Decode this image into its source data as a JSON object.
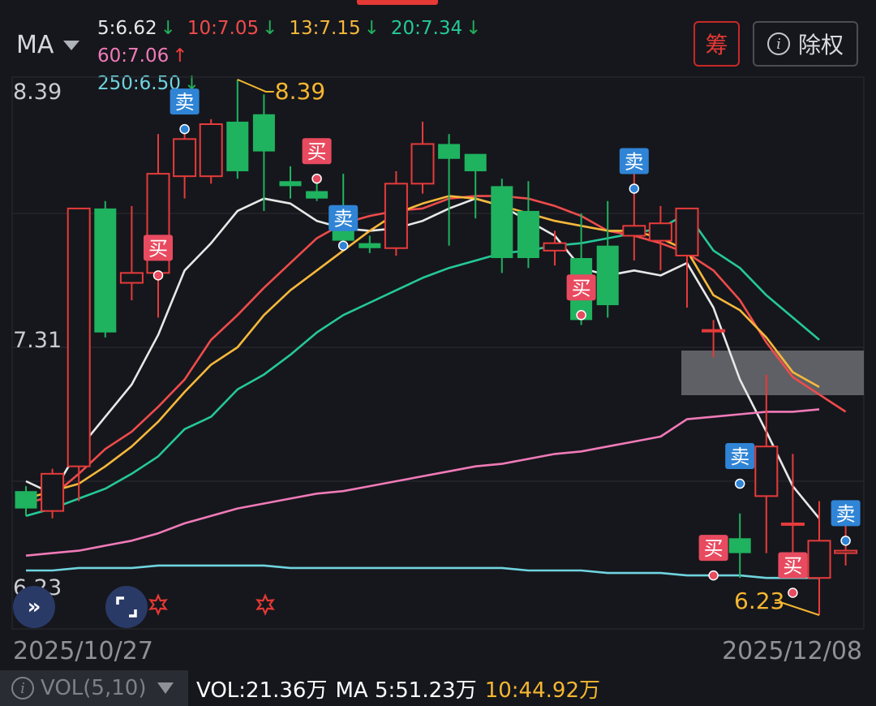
{
  "header": {
    "ma_selector": "MA",
    "chip_button": "筹",
    "rights_button": "除权",
    "legend": [
      {
        "text": "5:6.62",
        "arrow": "↓",
        "color": "#e8e8e8",
        "arrow_color": "#20b15b"
      },
      {
        "text": "10:7.05",
        "arrow": "↓",
        "color": "#ef4b4b",
        "arrow_color": "#20b15b"
      },
      {
        "text": "13:7.15",
        "arrow": "↓",
        "color": "#f6b83c",
        "arrow_color": "#20b15b"
      },
      {
        "text": "20:7.34",
        "arrow": "↓",
        "color": "#25c89a",
        "arrow_color": "#20b15b"
      },
      {
        "text": "60:7.06",
        "arrow": "↑",
        "color": "#f07ab8",
        "arrow_color": "#ef3b3b"
      },
      {
        "text": "250:6.50",
        "arrow": "↓",
        "color": "#6fd4df",
        "arrow_color": "#20b15b"
      }
    ]
  },
  "colors": {
    "up": "#e53b3b",
    "down": "#1fb35f",
    "signal_buy": "#e84a5f",
    "signal_sell": "#2f84d6",
    "annotation": "#f5b631",
    "star": "#e53935"
  },
  "chart_data": {
    "type": "candlestick",
    "x_start_label": "2025/10/27",
    "x_end_label": "2025/12/08",
    "y_axis_labels": [
      "8.39",
      "7.31",
      "6.23"
    ],
    "ylim": [
      6.23,
      8.39
    ],
    "high_annotation": "8.39",
    "low_annotation": "6.23",
    "candles": [
      {
        "o": 6.73,
        "h": 6.75,
        "l": 6.63,
        "c": 6.66
      },
      {
        "o": 6.65,
        "h": 6.82,
        "l": 6.62,
        "c": 6.8
      },
      {
        "o": 6.83,
        "h": 7.87,
        "l": 6.69,
        "c": 7.87
      },
      {
        "o": 7.87,
        "h": 7.9,
        "l": 7.35,
        "c": 7.37
      },
      {
        "o": 7.57,
        "h": 7.88,
        "l": 7.5,
        "c": 7.61
      },
      {
        "o": 7.61,
        "h": 8.17,
        "l": 7.43,
        "c": 8.01
      },
      {
        "o": 8.0,
        "h": 8.19,
        "l": 7.91,
        "c": 8.15
      },
      {
        "o": 8.0,
        "h": 8.23,
        "l": 7.97,
        "c": 8.21
      },
      {
        "o": 8.22,
        "h": 8.39,
        "l": 7.99,
        "c": 8.02
      },
      {
        "o": 8.25,
        "h": 8.33,
        "l": 7.86,
        "c": 8.1
      },
      {
        "o": 7.98,
        "h": 8.04,
        "l": 7.91,
        "c": 7.96
      },
      {
        "o": 7.94,
        "h": 7.99,
        "l": 7.9,
        "c": 7.91
      },
      {
        "o": 7.86,
        "h": 8.01,
        "l": 7.77,
        "c": 7.74
      },
      {
        "o": 7.73,
        "h": 7.76,
        "l": 7.69,
        "c": 7.71
      },
      {
        "o": 7.71,
        "h": 8.02,
        "l": 7.68,
        "c": 7.97
      },
      {
        "o": 7.97,
        "h": 8.22,
        "l": 7.93,
        "c": 8.13
      },
      {
        "o": 8.13,
        "h": 8.17,
        "l": 7.72,
        "c": 8.07
      },
      {
        "o": 8.09,
        "h": 8.05,
        "l": 7.83,
        "c": 8.02
      },
      {
        "o": 7.96,
        "h": 7.99,
        "l": 7.61,
        "c": 7.67
      },
      {
        "o": 7.86,
        "h": 7.98,
        "l": 7.63,
        "c": 7.67
      },
      {
        "o": 7.7,
        "h": 7.78,
        "l": 7.64,
        "c": 7.73
      },
      {
        "o": 7.67,
        "h": 7.85,
        "l": 7.4,
        "c": 7.42
      },
      {
        "o": 7.72,
        "h": 7.9,
        "l": 7.43,
        "c": 7.48
      },
      {
        "o": 7.76,
        "h": 8.08,
        "l": 7.66,
        "c": 7.8
      },
      {
        "o": 7.74,
        "h": 7.88,
        "l": 7.62,
        "c": 7.81
      },
      {
        "o": 7.68,
        "h": 7.83,
        "l": 7.47,
        "c": 7.87
      },
      {
        "o": 7.38,
        "h": 7.42,
        "l": 7.27,
        "c": 7.38
      },
      {
        "o": 6.54,
        "h": 6.64,
        "l": 6.38,
        "c": 6.48
      },
      {
        "o": 6.71,
        "h": 7.2,
        "l": 6.48,
        "c": 6.91
      },
      {
        "o": 6.6,
        "h": 6.88,
        "l": 6.4,
        "c": 6.6
      },
      {
        "o": 6.38,
        "h": 6.69,
        "l": 6.23,
        "c": 6.53
      },
      {
        "o": 6.48,
        "h": 6.62,
        "l": 6.43,
        "c": 6.49
      }
    ],
    "series": [
      {
        "name": "MA5",
        "color": "#e8e8e8",
        "values": [
          6.77,
          6.72,
          6.9,
          7.03,
          7.16,
          7.36,
          7.62,
          7.73,
          7.86,
          7.91,
          7.89,
          7.82,
          7.79,
          7.78,
          7.79,
          7.82,
          7.87,
          7.91,
          7.88,
          7.82,
          7.76,
          7.63,
          7.6,
          7.62,
          7.6,
          7.65,
          7.47,
          7.18,
          6.97,
          6.75,
          6.62
        ]
      },
      {
        "name": "MA10",
        "color": "#ef4b4b",
        "values": [
          6.68,
          6.71,
          6.8,
          6.9,
          6.97,
          7.07,
          7.18,
          7.34,
          7.44,
          7.55,
          7.65,
          7.75,
          7.81,
          7.84,
          7.86,
          7.87,
          7.91,
          7.92,
          7.92,
          7.91,
          7.88,
          7.84,
          7.78,
          7.76,
          7.73,
          7.69,
          7.62,
          7.5,
          7.33,
          7.19,
          7.12,
          7.05
        ]
      },
      {
        "name": "MA13",
        "color": "#f6b83c",
        "values": [
          6.7,
          6.73,
          6.76,
          6.83,
          6.91,
          7.01,
          7.13,
          7.24,
          7.31,
          7.44,
          7.54,
          7.62,
          7.7,
          7.78,
          7.85,
          7.89,
          7.92,
          7.91,
          7.88,
          7.85,
          7.82,
          7.8,
          7.78,
          7.78,
          7.75,
          7.7,
          7.52,
          7.46,
          7.35,
          7.21,
          7.15
        ]
      },
      {
        "name": "MA20",
        "color": "#25c89a",
        "values": [
          6.63,
          6.66,
          6.7,
          6.74,
          6.8,
          6.87,
          6.98,
          7.03,
          7.14,
          7.2,
          7.28,
          7.37,
          7.44,
          7.49,
          7.54,
          7.59,
          7.63,
          7.66,
          7.69,
          7.7,
          7.72,
          7.73,
          7.75,
          7.77,
          7.79,
          7.85,
          7.7,
          7.63,
          7.52,
          7.43,
          7.34
        ]
      },
      {
        "name": "MA60",
        "color": "#f07ab8",
        "values": [
          6.47,
          6.48,
          6.49,
          6.51,
          6.53,
          6.56,
          6.6,
          6.63,
          6.66,
          6.68,
          6.7,
          6.72,
          6.73,
          6.75,
          6.77,
          6.79,
          6.81,
          6.83,
          6.84,
          6.86,
          6.88,
          6.89,
          6.91,
          6.93,
          6.95,
          7.02,
          7.03,
          7.04,
          7.05,
          7.05,
          7.06
        ]
      },
      {
        "name": "MA250",
        "color": "#6fd4df",
        "values": [
          6.41,
          6.41,
          6.42,
          6.42,
          6.42,
          6.43,
          6.43,
          6.43,
          6.43,
          6.43,
          6.42,
          6.42,
          6.42,
          6.42,
          6.42,
          6.42,
          6.42,
          6.42,
          6.42,
          6.41,
          6.41,
          6.41,
          6.4,
          6.4,
          6.4,
          6.39,
          6.39,
          6.39,
          6.38,
          6.38,
          6.38
        ]
      }
    ],
    "signals": [
      {
        "idx": 5,
        "type": "buy",
        "label": "买",
        "price": 7.6
      },
      {
        "idx": 6,
        "type": "sell",
        "label": "卖",
        "price": 8.19
      },
      {
        "idx": 11,
        "type": "buy",
        "label": "买",
        "price": 7.99
      },
      {
        "idx": 12,
        "type": "sell",
        "label": "卖",
        "price": 7.72
      },
      {
        "idx": 21,
        "type": "buy",
        "label": "买",
        "price": 7.44
      },
      {
        "idx": 23,
        "type": "sell",
        "label": "卖",
        "price": 7.95
      },
      {
        "idx": 26,
        "type": "buy",
        "label": "买",
        "price": 6.39
      },
      {
        "idx": 27,
        "type": "sell",
        "label": "卖",
        "price": 6.76
      },
      {
        "idx": 29,
        "type": "buy",
        "label": "买",
        "price": 6.32
      },
      {
        "idx": 31,
        "type": "sell",
        "label": "卖",
        "price": 6.53
      }
    ]
  },
  "volume_bar": {
    "indicator_select": "VOL(5,10)",
    "vol_text": "VOL:21.36万",
    "ma5_text": "MA 5:51.23万",
    "ma10_text": "10:44.92万"
  }
}
